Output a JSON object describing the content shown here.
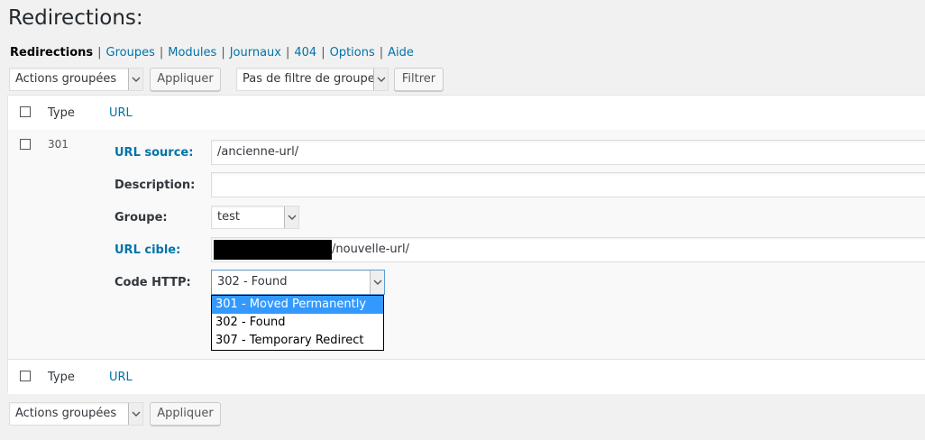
{
  "page": {
    "title": "Redirections:"
  },
  "subnav": {
    "current": "Redirections",
    "items": [
      "Groupes",
      "Modules",
      "Journaux",
      "404",
      "Options",
      "Aide"
    ],
    "separator": "|"
  },
  "top_bar": {
    "bulk_actions": "Actions groupées",
    "apply": "Appliquer",
    "group_filter": "Pas de filtre de groupe",
    "filter": "Filtrer"
  },
  "table": {
    "col_type": "Type",
    "col_url": "URL",
    "row": {
      "type_value": "301",
      "source_label": "URL source:",
      "source_value": "/ancienne-url/",
      "description_label": "Description:",
      "description_value": "",
      "group_label": "Groupe:",
      "group_value": "test",
      "target_label": "URL cible:",
      "target_value": "/nouvelle-url/",
      "http_label": "Code HTTP:",
      "http_value": "302 - Found",
      "http_options": [
        "301 - Moved Permanently",
        "302 - Found",
        "307 - Temporary Redirect"
      ],
      "highlighted_option": "301 - Moved Permanently"
    }
  },
  "bottom_bar": {
    "bulk_actions": "Actions groupées",
    "apply": "Appliquer"
  },
  "colors": {
    "link": "#0073aa",
    "highlight": "#3399ff",
    "background": "#f1f1f1"
  }
}
